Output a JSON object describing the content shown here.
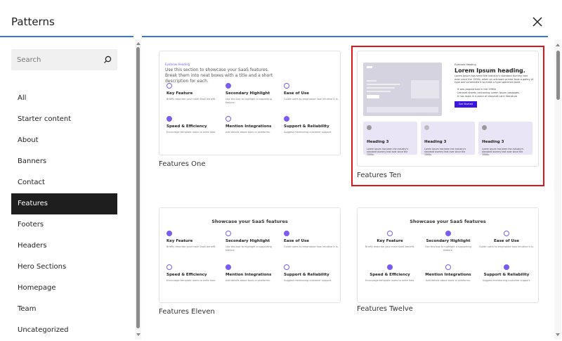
{
  "header": {
    "title": "Patterns",
    "close_icon": "close-icon"
  },
  "search": {
    "placeholder": "Search"
  },
  "categories": [
    "All",
    "Starter content",
    "About",
    "Banners",
    "Contact",
    "Features",
    "Footers",
    "Headers",
    "Hero Sections",
    "Homepage",
    "Team",
    "Uncategorized"
  ],
  "active_category": "Features",
  "accent_color": "#3a78d6",
  "selection_color": "#e0141a",
  "patterns": [
    {
      "label": "Features One",
      "eyebrow": "Eyebrow Heading",
      "heading": "Use this section to showcase your SaaS features. Break them into neat boxes with a title and a short description for each.",
      "items": [
        "Key Feature",
        "Secondary Highlight",
        "Ease of Use",
        "Speed & Efficiency",
        "Mention Integrations",
        "Support & Reliability"
      ]
    },
    {
      "label": "Features Ten",
      "eyebrow": "Eyebrow Heading",
      "heading": "Lorem Ipsum heading.",
      "body": "Lorem Ipsum has been the industry's standard dummy text ever since the 1500s, when an unknown printer took a galley of type and scrambled it to make a type specimen book.",
      "bullets": [
        "It was popularised in the 1960s",
        "Letraset sheets containing Lorem Ipsum passages",
        "It has roots in a piece of classical Latin literature"
      ],
      "button": "Get Started",
      "cards": [
        "Heading 3",
        "Heading 3",
        "Heading 3"
      ]
    },
    {
      "label": "Features Eleven",
      "heading": "Showcase your SaaS features",
      "items": [
        "Key Feature",
        "Secondary Highlight",
        "Ease of Use",
        "Speed & Efficiency",
        "Mention Integrations",
        "Support & Reliability"
      ]
    },
    {
      "label": "Features Twelve",
      "heading": "Showcase your SaaS features",
      "items": [
        "Key Feature",
        "Secondary Highlight",
        "Ease of Use",
        "Speed & Efficiency",
        "Mention Integrations",
        "Support & Reliability"
      ]
    }
  ]
}
